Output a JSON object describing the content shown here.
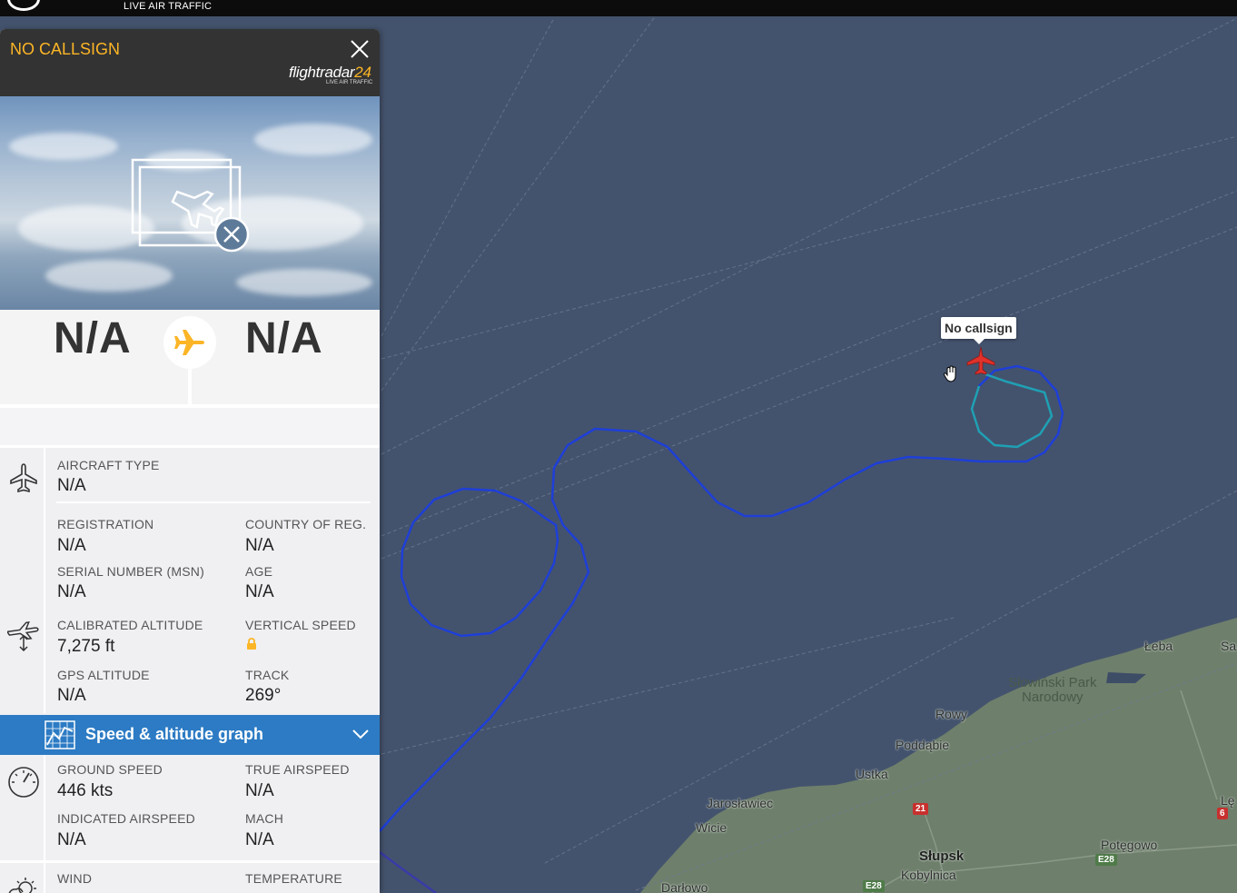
{
  "topbar": {
    "logo_subtitle": "LIVE AIR TRAFFIC"
  },
  "panel": {
    "callsign": "NO CALLSIGN",
    "brand": {
      "name": "flightradar",
      "number": "24",
      "subtitle": "LIVE AIR TRAFFIC"
    },
    "route": {
      "origin": "N/A",
      "destination": "N/A"
    },
    "aircraft": {
      "type_label": "AIRCRAFT TYPE",
      "type_value": "N/A",
      "registration_label": "REGISTRATION",
      "registration_value": "N/A",
      "country_label": "COUNTRY OF REG.",
      "country_value": "N/A",
      "serial_label": "SERIAL NUMBER (MSN)",
      "serial_value": "N/A",
      "age_label": "AGE",
      "age_value": "N/A"
    },
    "altitude": {
      "calibrated_label": "CALIBRATED ALTITUDE",
      "calibrated_value": "7,275 ft",
      "vertical_speed_label": "VERTICAL SPEED",
      "vertical_speed_icon": "lock-icon",
      "gps_label": "GPS ALTITUDE",
      "gps_value": "N/A",
      "track_label": "TRACK",
      "track_value": "269°"
    },
    "graph_bar": {
      "label": "Speed & altitude graph"
    },
    "speed": {
      "ground_label": "GROUND SPEED",
      "ground_value": "446 kts",
      "true_label": "TRUE AIRSPEED",
      "true_value": "N/A",
      "indicated_label": "INDICATED AIRSPEED",
      "indicated_value": "N/A",
      "mach_label": "MACH",
      "mach_value": "N/A"
    },
    "weather": {
      "wind_label": "WIND",
      "temperature_label": "TEMPERATURE"
    }
  },
  "map": {
    "aircraft_tooltip": "No callsign",
    "places": {
      "leba": "Łeba",
      "sa": "Sa",
      "slowinski": "Słowiński Park",
      "narodowy": "Narodowy",
      "rowy": "Rowy",
      "poddabie": "Poddąbie",
      "ustka": "Ustka",
      "jaroslawiec": "Jarosławiec",
      "wicie": "Wicie",
      "slupsk": "Słupsk",
      "kobylnica": "Kobylnica",
      "potegowo": "Potęgowo",
      "darlowo": "Darłowo",
      "le": "Lę"
    },
    "roads": {
      "r21": "21",
      "e28a": "E28",
      "e28b": "E28",
      "r6": "6"
    },
    "colors": {
      "sea": "#44536d",
      "land": "#6e7f6c",
      "track_main": "#1e3fd8",
      "track_recent": "#1fa0b4",
      "aircraft": "#e0312b"
    }
  }
}
